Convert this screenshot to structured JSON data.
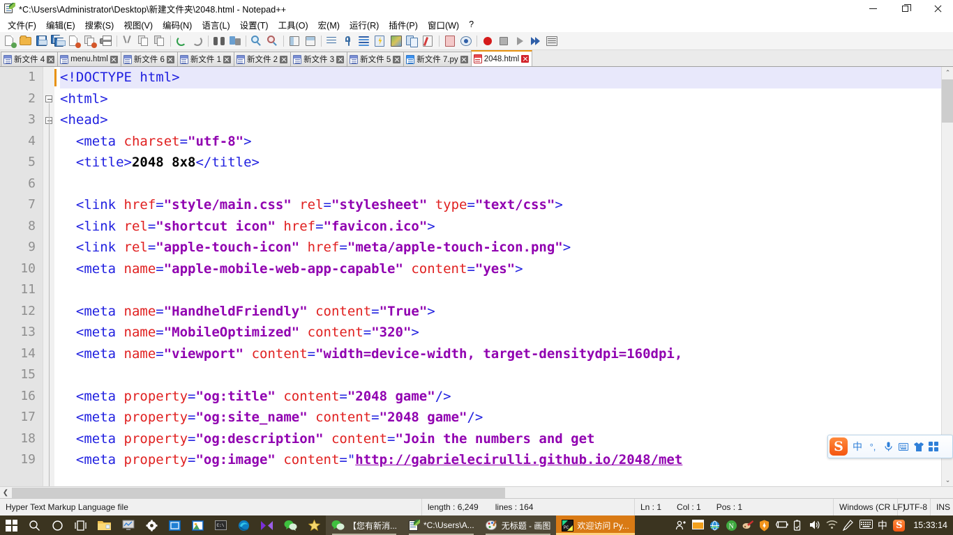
{
  "window": {
    "title": "*C:\\Users\\Administrator\\Desktop\\新建文件夹\\2048.html - Notepad++",
    "minimize_label": "−",
    "maximize_label": "❐",
    "close_label": "✕"
  },
  "menubar": {
    "items": [
      {
        "label": "文件(F)",
        "name": "menu-file"
      },
      {
        "label": "编辑(E)",
        "name": "menu-edit"
      },
      {
        "label": "搜索(S)",
        "name": "menu-search"
      },
      {
        "label": "视图(V)",
        "name": "menu-view"
      },
      {
        "label": "编码(N)",
        "name": "menu-encoding"
      },
      {
        "label": "语言(L)",
        "name": "menu-language"
      },
      {
        "label": "设置(T)",
        "name": "menu-settings"
      },
      {
        "label": "工具(O)",
        "name": "menu-tools"
      },
      {
        "label": "宏(M)",
        "name": "menu-macro"
      },
      {
        "label": "运行(R)",
        "name": "menu-run"
      },
      {
        "label": "插件(P)",
        "name": "menu-plugins"
      },
      {
        "label": "窗口(W)",
        "name": "menu-window"
      },
      {
        "label": "?",
        "name": "menu-help"
      }
    ]
  },
  "toolbar": {
    "icons": [
      "new-file-icon",
      "open-file-icon",
      "save-icon",
      "save-all-icon",
      "close-file-icon",
      "close-all-icon",
      "print-icon",
      "SEP",
      "cut-icon",
      "copy-icon",
      "paste-icon",
      "SEP",
      "undo-icon",
      "redo-icon",
      "SEP",
      "find-icon",
      "replace-icon",
      "SEP",
      "zoom-in-icon",
      "zoom-out-icon",
      "SEP",
      "sync-vertical-icon",
      "sync-horizontal-icon",
      "SEP",
      "word-wrap-icon",
      "show-all-chars-icon",
      "indent-guide-icon",
      "user-defined-lang-icon",
      "show-map-icon",
      "clone-doc-icon",
      "link-icon",
      "SEP",
      "clipboard-history-icon",
      "monitor-icon",
      "SEP",
      "record-macro-icon",
      "stop-macro-icon",
      "play-macro-icon",
      "run-macro-multiple-icon",
      "save-macro-icon"
    ]
  },
  "tabs": {
    "items": [
      {
        "label": "新文件 4",
        "icon": "doc-icon-purple",
        "active": false
      },
      {
        "label": "menu.html",
        "icon": "doc-icon-purple",
        "active": false
      },
      {
        "label": "新文件 6",
        "icon": "doc-icon-purple",
        "active": false
      },
      {
        "label": "新文件 1",
        "icon": "doc-icon-purple",
        "active": false
      },
      {
        "label": "新文件 2",
        "icon": "doc-icon-purple",
        "active": false
      },
      {
        "label": "新文件 3",
        "icon": "doc-icon-purple",
        "active": false
      },
      {
        "label": "新文件 5",
        "icon": "doc-icon-purple",
        "active": false
      },
      {
        "label": "新文件 7.py",
        "icon": "doc-icon-blue",
        "active": false
      },
      {
        "label": "2048.html",
        "icon": "doc-icon-red",
        "active": true
      }
    ]
  },
  "editor": {
    "first_line": 1,
    "line_numbers": [
      1,
      2,
      3,
      4,
      5,
      6,
      7,
      8,
      9,
      10,
      11,
      12,
      13,
      14,
      15,
      16,
      17,
      18,
      19
    ],
    "lines": [
      {
        "n": 1,
        "segments": [
          {
            "t": "tag",
            "v": "<!DOCTYPE html>"
          }
        ]
      },
      {
        "n": 2,
        "segments": [
          {
            "t": "tag",
            "v": "<html>"
          }
        ]
      },
      {
        "n": 3,
        "segments": [
          {
            "t": "tag",
            "v": "<head>"
          }
        ]
      },
      {
        "n": 4,
        "segments": [
          {
            "t": "tag",
            "v": "  <meta "
          },
          {
            "t": "attr",
            "v": "charset"
          },
          {
            "t": "tag",
            "v": "="
          },
          {
            "t": "val",
            "v": "\"utf-8\""
          },
          {
            "t": "tag",
            "v": ">"
          }
        ]
      },
      {
        "n": 5,
        "segments": [
          {
            "t": "tag",
            "v": "  <title>"
          },
          {
            "t": "txt",
            "v": "2048 8x8"
          },
          {
            "t": "tag",
            "v": "</title>"
          }
        ]
      },
      {
        "n": 6,
        "segments": []
      },
      {
        "n": 7,
        "segments": [
          {
            "t": "tag",
            "v": "  <link "
          },
          {
            "t": "attr",
            "v": "href"
          },
          {
            "t": "tag",
            "v": "="
          },
          {
            "t": "val",
            "v": "\"style/main.css\""
          },
          {
            "t": "tag",
            "v": " "
          },
          {
            "t": "attr",
            "v": "rel"
          },
          {
            "t": "tag",
            "v": "="
          },
          {
            "t": "val",
            "v": "\"stylesheet\""
          },
          {
            "t": "tag",
            "v": " "
          },
          {
            "t": "attr",
            "v": "type"
          },
          {
            "t": "tag",
            "v": "="
          },
          {
            "t": "val",
            "v": "\"text/css\""
          },
          {
            "t": "tag",
            "v": ">"
          }
        ]
      },
      {
        "n": 8,
        "segments": [
          {
            "t": "tag",
            "v": "  <link "
          },
          {
            "t": "attr",
            "v": "rel"
          },
          {
            "t": "tag",
            "v": "="
          },
          {
            "t": "val",
            "v": "\"shortcut icon\""
          },
          {
            "t": "tag",
            "v": " "
          },
          {
            "t": "attr",
            "v": "href"
          },
          {
            "t": "tag",
            "v": "="
          },
          {
            "t": "val",
            "v": "\"favicon.ico\""
          },
          {
            "t": "tag",
            "v": ">"
          }
        ]
      },
      {
        "n": 9,
        "segments": [
          {
            "t": "tag",
            "v": "  <link "
          },
          {
            "t": "attr",
            "v": "rel"
          },
          {
            "t": "tag",
            "v": "="
          },
          {
            "t": "val",
            "v": "\"apple-touch-icon\""
          },
          {
            "t": "tag",
            "v": " "
          },
          {
            "t": "attr",
            "v": "href"
          },
          {
            "t": "tag",
            "v": "="
          },
          {
            "t": "val",
            "v": "\"meta/apple-touch-icon.png\""
          },
          {
            "t": "tag",
            "v": ">"
          }
        ]
      },
      {
        "n": 10,
        "segments": [
          {
            "t": "tag",
            "v": "  <meta "
          },
          {
            "t": "attr",
            "v": "name"
          },
          {
            "t": "tag",
            "v": "="
          },
          {
            "t": "val",
            "v": "\"apple-mobile-web-app-capable\""
          },
          {
            "t": "tag",
            "v": " "
          },
          {
            "t": "attr",
            "v": "content"
          },
          {
            "t": "tag",
            "v": "="
          },
          {
            "t": "val",
            "v": "\"yes\""
          },
          {
            "t": "tag",
            "v": ">"
          }
        ]
      },
      {
        "n": 11,
        "segments": []
      },
      {
        "n": 12,
        "segments": [
          {
            "t": "tag",
            "v": "  <meta "
          },
          {
            "t": "attr",
            "v": "name"
          },
          {
            "t": "tag",
            "v": "="
          },
          {
            "t": "val",
            "v": "\"HandheldFriendly\""
          },
          {
            "t": "tag",
            "v": " "
          },
          {
            "t": "attr",
            "v": "content"
          },
          {
            "t": "tag",
            "v": "="
          },
          {
            "t": "val",
            "v": "\"True\""
          },
          {
            "t": "tag",
            "v": ">"
          }
        ]
      },
      {
        "n": 13,
        "segments": [
          {
            "t": "tag",
            "v": "  <meta "
          },
          {
            "t": "attr",
            "v": "name"
          },
          {
            "t": "tag",
            "v": "="
          },
          {
            "t": "val",
            "v": "\"MobileOptimized\""
          },
          {
            "t": "tag",
            "v": " "
          },
          {
            "t": "attr",
            "v": "content"
          },
          {
            "t": "tag",
            "v": "="
          },
          {
            "t": "val",
            "v": "\"320\""
          },
          {
            "t": "tag",
            "v": ">"
          }
        ]
      },
      {
        "n": 14,
        "segments": [
          {
            "t": "tag",
            "v": "  <meta "
          },
          {
            "t": "attr",
            "v": "name"
          },
          {
            "t": "tag",
            "v": "="
          },
          {
            "t": "val",
            "v": "\"viewport\""
          },
          {
            "t": "tag",
            "v": " "
          },
          {
            "t": "attr",
            "v": "content"
          },
          {
            "t": "tag",
            "v": "="
          },
          {
            "t": "val",
            "v": "\"width=device-width, target-densitydpi=160dpi,"
          }
        ]
      },
      {
        "n": 15,
        "segments": []
      },
      {
        "n": 16,
        "segments": [
          {
            "t": "tag",
            "v": "  <meta "
          },
          {
            "t": "attr",
            "v": "property"
          },
          {
            "t": "tag",
            "v": "="
          },
          {
            "t": "val",
            "v": "\"og:title\""
          },
          {
            "t": "tag",
            "v": " "
          },
          {
            "t": "attr",
            "v": "content"
          },
          {
            "t": "tag",
            "v": "="
          },
          {
            "t": "val",
            "v": "\"2048 game\""
          },
          {
            "t": "tag",
            "v": "/>"
          }
        ]
      },
      {
        "n": 17,
        "segments": [
          {
            "t": "tag",
            "v": "  <meta "
          },
          {
            "t": "attr",
            "v": "property"
          },
          {
            "t": "tag",
            "v": "="
          },
          {
            "t": "val",
            "v": "\"og:site_name\""
          },
          {
            "t": "tag",
            "v": " "
          },
          {
            "t": "attr",
            "v": "content"
          },
          {
            "t": "tag",
            "v": "="
          },
          {
            "t": "val",
            "v": "\"2048 game\""
          },
          {
            "t": "tag",
            "v": "/>"
          }
        ]
      },
      {
        "n": 18,
        "segments": [
          {
            "t": "tag",
            "v": "  <meta "
          },
          {
            "t": "attr",
            "v": "property"
          },
          {
            "t": "tag",
            "v": "="
          },
          {
            "t": "val",
            "v": "\"og:description\""
          },
          {
            "t": "tag",
            "v": " "
          },
          {
            "t": "attr",
            "v": "content"
          },
          {
            "t": "tag",
            "v": "="
          },
          {
            "t": "val",
            "v": "\"Join the numbers and get "
          }
        ]
      },
      {
        "n": 19,
        "segments": [
          {
            "t": "tag",
            "v": "  <meta "
          },
          {
            "t": "attr",
            "v": "property"
          },
          {
            "t": "tag",
            "v": "="
          },
          {
            "t": "val",
            "v": "\"og:image\""
          },
          {
            "t": "tag",
            "v": " "
          },
          {
            "t": "attr",
            "v": "content"
          },
          {
            "t": "tag",
            "v": "=\""
          },
          {
            "t": "link",
            "v": "http://gabrielecirulli.github.io/2048/met"
          }
        ]
      }
    ],
    "colors": {
      "tag": "#2020e0",
      "attribute": "#e02020",
      "value": "#9000b0",
      "text": "#000000",
      "caret": "#e8920e",
      "current_line_bg": "#e8e8fb",
      "gutter_bg": "#e4e4e4",
      "gutter_text": "#8f8f8f"
    }
  },
  "statusbar": {
    "filetype": "Hyper Text Markup Language file",
    "length_label": "length : 6,249",
    "lines_label": "lines : 164",
    "ln": "Ln : 1",
    "col": "Col : 1",
    "pos": "Pos : 1",
    "eol": "Windows (CR LF)",
    "encoding": "UTF-8",
    "insert_mode": "INS"
  },
  "ime": {
    "logo": "S",
    "items": [
      "中",
      "°,",
      "🎤",
      "⌨",
      "👕",
      "apps"
    ],
    "names": [
      "sogou-logo-icon",
      "ime-chinese-mode-icon",
      "ime-punctuation-icon",
      "ime-voice-input-icon",
      "ime-soft-keyboard-icon",
      "ime-skin-icon",
      "ime-apps-icon"
    ]
  },
  "taskbar": {
    "pinned": [
      {
        "name": "start-button",
        "label": ""
      },
      {
        "name": "search-icon",
        "label": ""
      },
      {
        "name": "cortana-icon",
        "label": ""
      },
      {
        "name": "task-view-icon",
        "label": ""
      },
      {
        "name": "file-explorer-icon",
        "label": ""
      },
      {
        "name": "monitor-app-icon",
        "label": ""
      },
      {
        "name": "settings-gear-icon",
        "label": ""
      },
      {
        "name": "blue-app-icon",
        "label": ""
      },
      {
        "name": "photos-app-icon",
        "label": ""
      },
      {
        "name": "command-prompt-icon",
        "label": ""
      },
      {
        "name": "edge-browser-icon",
        "label": ""
      },
      {
        "name": "purple-bowtie-icon",
        "label": ""
      },
      {
        "name": "wechat-icon",
        "label": ""
      },
      {
        "name": "star-app-icon",
        "label": ""
      }
    ],
    "windows": [
      {
        "label": "【您有新消...",
        "icon": "wechat-window-icon",
        "state": "running"
      },
      {
        "label": "*C:\\Users\\A...",
        "icon": "notepadpp-window-icon",
        "state": "running"
      },
      {
        "label": "无标题 - 画图",
        "icon": "paint-window-icon",
        "state": "running"
      },
      {
        "label": "欢迎访问 Py...",
        "icon": "pycharm-window-icon",
        "state": "active"
      }
    ],
    "tray": [
      "show-hidden-icons",
      "window-tray-icon",
      "network-globe-icon",
      "nvidia-icon",
      "app-tray-icon",
      "shield-icon",
      "battery-icon",
      "usb-eject-icon",
      "volume-icon",
      "wifi-icon",
      "pen-icon",
      "touch-keyboard-icon",
      "ime-mode-cn-icon",
      "sogou-tray-icon"
    ],
    "clock": "15:33:14"
  }
}
